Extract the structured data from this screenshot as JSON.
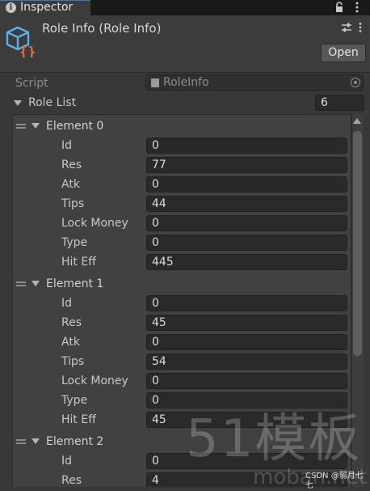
{
  "window": {
    "tab_label": "Inspector",
    "tab_icon": "info-icon"
  },
  "header": {
    "title": "Role Info (Role Info)",
    "open_label": "Open",
    "icon": "script-cube-icon"
  },
  "script_field": {
    "label": "Script",
    "value": "RoleInfo"
  },
  "role_list": {
    "label": "Role List",
    "size": "6",
    "elements": [
      {
        "label": "Element 0",
        "fields": [
          {
            "name": "Id",
            "value": "0"
          },
          {
            "name": "Res",
            "value": "77"
          },
          {
            "name": "Atk",
            "value": "0"
          },
          {
            "name": "Tips",
            "value": "44"
          },
          {
            "name": "Lock Money",
            "value": "0"
          },
          {
            "name": "Type",
            "value": "0"
          },
          {
            "name": "Hit Eff",
            "value": "445"
          }
        ]
      },
      {
        "label": "Element 1",
        "fields": [
          {
            "name": "Id",
            "value": "0"
          },
          {
            "name": "Res",
            "value": "45"
          },
          {
            "name": "Atk",
            "value": "0"
          },
          {
            "name": "Tips",
            "value": "54"
          },
          {
            "name": "Lock Money",
            "value": "0"
          },
          {
            "name": "Type",
            "value": "0"
          },
          {
            "name": "Hit Eff",
            "value": "45"
          }
        ]
      },
      {
        "label": "Element 2",
        "fields": [
          {
            "name": "Id",
            "value": "0"
          },
          {
            "name": "Res",
            "value": "4"
          }
        ]
      }
    ]
  },
  "watermark": {
    "main": "51模板",
    "sub": "moban.net",
    "credit": "CSDN @弱月七七"
  },
  "colors": {
    "background": "#383838",
    "header": "#3c3c3c",
    "field": "#2a2a2a",
    "accent": "#3a79bb"
  }
}
